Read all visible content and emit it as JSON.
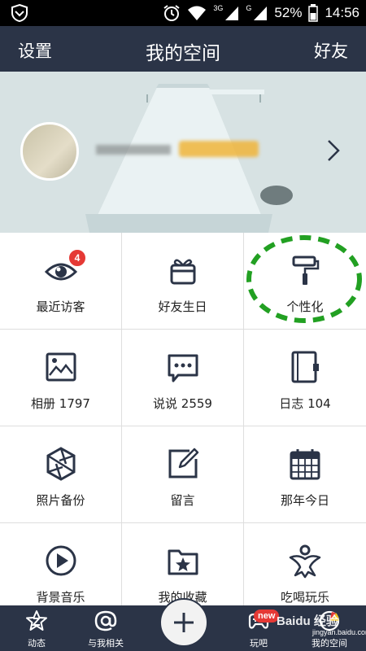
{
  "status_bar": {
    "net_3g": "3G",
    "net_g": "G",
    "battery": "52%",
    "time": "14:56"
  },
  "nav": {
    "left": "设置",
    "title": "我的空间",
    "right": "好友"
  },
  "grid": {
    "items": [
      {
        "label": "最近访客",
        "icon": "eye-icon",
        "badge": "4"
      },
      {
        "label": "好友生日",
        "icon": "gift-icon"
      },
      {
        "label": "个性化",
        "icon": "paint-roller-icon"
      },
      {
        "label": "相册 1797",
        "icon": "photo-album-icon"
      },
      {
        "label": "说说 2559",
        "icon": "speech-bubble-icon"
      },
      {
        "label": "日志 104",
        "icon": "notebook-icon"
      },
      {
        "label": "照片备份",
        "icon": "shutter-icon"
      },
      {
        "label": "留言",
        "icon": "edit-note-icon"
      },
      {
        "label": "那年今日",
        "icon": "calendar-icon"
      },
      {
        "label": "背景音乐",
        "icon": "play-icon"
      },
      {
        "label": "我的收藏",
        "icon": "star-folder-icon"
      },
      {
        "label": "吃喝玩乐",
        "icon": "person-star-icon"
      }
    ]
  },
  "tabbar": {
    "items": [
      {
        "label": "动态",
        "icon": "star-z-icon"
      },
      {
        "label": "与我相关",
        "icon": "at-icon"
      },
      {
        "label": "玩吧",
        "icon": "gamepad-icon",
        "badge": "new"
      },
      {
        "label": "我的空间",
        "icon": "space-icon"
      }
    ],
    "plus_icon": "plus-icon"
  },
  "watermark": {
    "text": "Baidu 经验",
    "sub": "jingyan.baidu.com"
  },
  "colors": {
    "navbar": "#2b3447",
    "icon": "#2b3447",
    "badge": "#e53935",
    "highlight": "#22a022"
  }
}
